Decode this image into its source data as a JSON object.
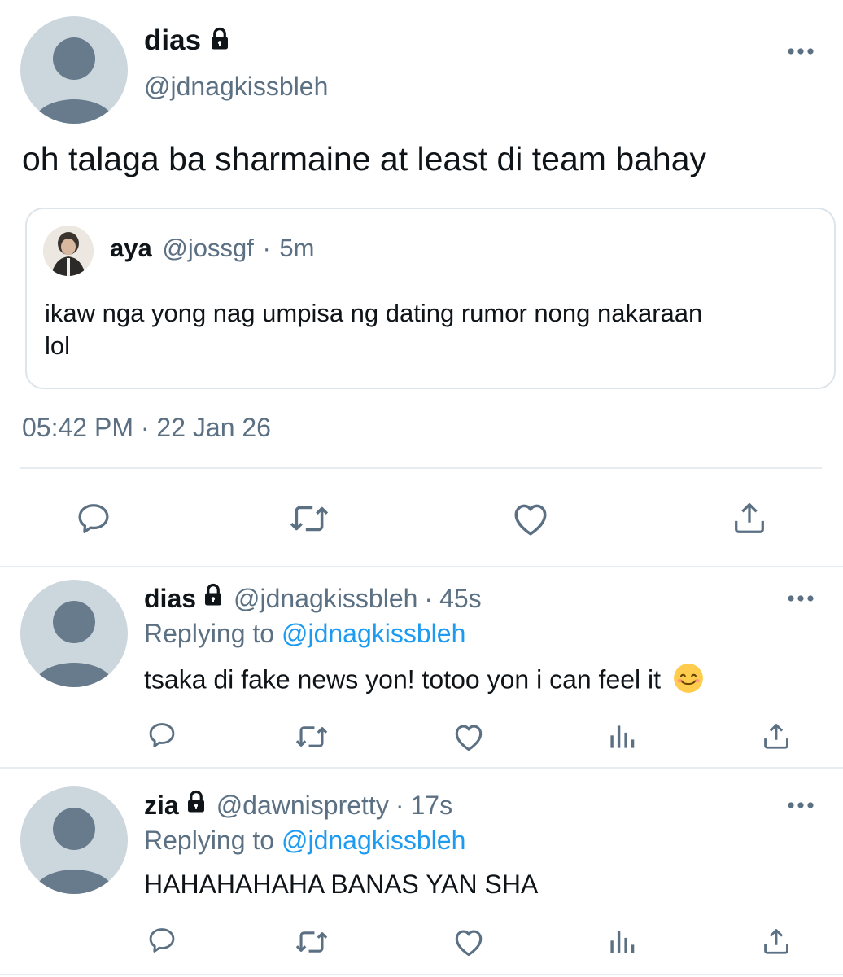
{
  "main_tweet": {
    "name": "dias",
    "handle": "@jdnagkissbleh",
    "text": "oh talaga ba sharmaine at least di team bahay",
    "quote": {
      "name": "aya",
      "handle": "@jossgf",
      "sep": "·",
      "time": "5m",
      "text_line1": "ikaw nga yong nag umpisa ng dating rumor nong nakaraan",
      "text_line2": "lol"
    },
    "time": "05:42 PM",
    "sep": "·",
    "date": "22 Jan 26"
  },
  "replies": [
    {
      "name": "dias",
      "handle": "@jdnagkissbleh",
      "sep": "·",
      "time": "45s",
      "replying_prefix": "Replying to",
      "replying_to": "@jdnagkissbleh",
      "text": "tsaka di fake news yon! totoo yon i can feel it",
      "emoji": "😊"
    },
    {
      "name": "zia",
      "handle": "@dawnispretty",
      "sep": "·",
      "time": "17s",
      "replying_prefix": "Replying to",
      "replying_to": "@jdnagkissbleh",
      "text": "HAHAHAHAHA BANAS YAN SHA"
    }
  ],
  "icons": {
    "reply": "speech-bubble-icon",
    "retweet": "retweet-arrows-icon",
    "like": "heart-icon",
    "views": "bar-chart-icon",
    "share": "upload-arrow-icon",
    "more": "three-dots-icon",
    "lock": "padlock-icon"
  },
  "colors": {
    "text": "#0f1419",
    "muted": "#5b7083",
    "link": "#1d9bf0",
    "avatar_bg": "#ccd6dd",
    "avatar_fg": "#677b8c",
    "divider": "#e6ecf0"
  }
}
